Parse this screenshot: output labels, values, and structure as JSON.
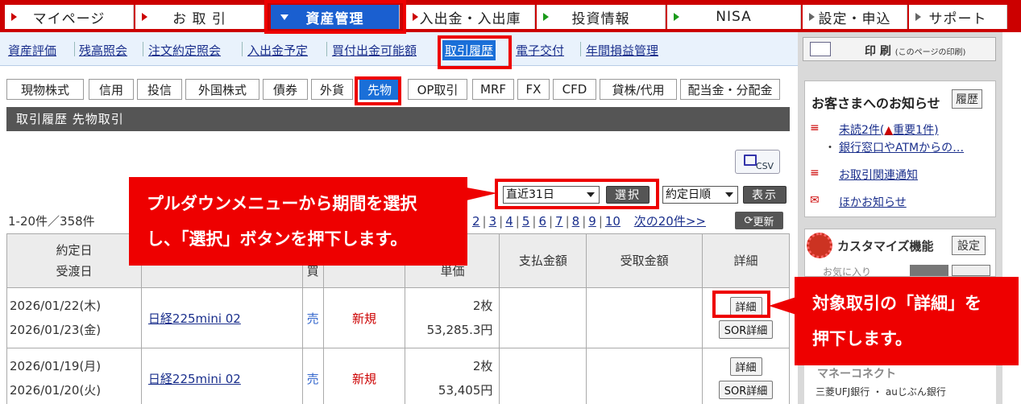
{
  "topnav": {
    "items": [
      {
        "label": "マイページ"
      },
      {
        "label": "お 取 引"
      },
      {
        "label": "資産管理"
      },
      {
        "label": "入出金・入出庫"
      },
      {
        "label": "投資情報"
      },
      {
        "label": "NISA"
      },
      {
        "label": "設定・申込"
      },
      {
        "label": "サポート"
      }
    ]
  },
  "subnav": {
    "items": [
      {
        "label": "資産評価"
      },
      {
        "label": "残高照会"
      },
      {
        "label": "注文約定照会"
      },
      {
        "label": "入出金予定"
      },
      {
        "label": "買付出金可能額"
      },
      {
        "label": "取引履歴"
      },
      {
        "label": "電子交付"
      },
      {
        "label": "年間損益管理"
      }
    ]
  },
  "tabs": [
    {
      "label": "現物株式"
    },
    {
      "label": "信用"
    },
    {
      "label": "投信"
    },
    {
      "label": "外国株式"
    },
    {
      "label": "債券"
    },
    {
      "label": "外貨"
    },
    {
      "label": "先物"
    },
    {
      "label": "OP取引"
    },
    {
      "label": "MRF"
    },
    {
      "label": "FX"
    },
    {
      "label": "CFD"
    },
    {
      "label": "貸株/代用"
    },
    {
      "label": "配当金・分配金"
    }
  ],
  "section_title": "取引履歴 先物取引",
  "csv_label": "CSV",
  "controls": {
    "period": "直近31日",
    "select_button": "選択",
    "sort": "約定日順",
    "show_button": "表示"
  },
  "count_text": "1-20件／358件",
  "pager": {
    "pages": [
      "2",
      "3",
      "4",
      "5",
      "6",
      "7",
      "8",
      "9",
      "10"
    ],
    "next": "次の20件>>",
    "refresh": "更新"
  },
  "table": {
    "headers": {
      "date_line1": "約定日",
      "date_line2": "受渡日",
      "side": "買",
      "qty_line2": "単価",
      "pay": "支払金額",
      "receive": "受取金額",
      "detail": "詳細"
    },
    "rows": [
      {
        "trade_date": "2026/01/22(木)",
        "settle_date": "2026/01/23(金)",
        "product": "日経225mini  02",
        "side": "売",
        "type": "新規",
        "qty": "2枚",
        "price": "53,285.3円",
        "detail": "詳細",
        "sor": "SOR詳細"
      },
      {
        "trade_date": "2026/01/19(月)",
        "settle_date": "2026/01/20(火)",
        "product": "日経225mini  02",
        "side": "売",
        "type": "新規",
        "qty": "2枚",
        "price": "53,405円",
        "detail": "詳細",
        "sor": "SOR詳細"
      }
    ]
  },
  "side": {
    "print_label": "印 刷",
    "print_sub": "(このページの印刷)",
    "notice_title": "お客さまへのお知らせ",
    "history_button": "履歴",
    "notice_unread": "未読2件(",
    "notice_important": "重要1件)",
    "notice_bank": "銀行窓口やATMからの…",
    "notice_trade": "お取引関連通知",
    "notice_other": "ほかお知らせ",
    "custom_title": "カスタマイズ機能",
    "custom_setting": "設定",
    "custom_fav": "お気に入り",
    "money_connect": "マネーコネクト",
    "bank_names": "三菱UFJ銀行 ・ auじぶん銀行"
  },
  "callouts": {
    "period_help": [
      "プルダウンメニューから期間を選択",
      "し、「選択」ボタンを押下します。"
    ],
    "detail_help": [
      "対象取引の「詳細」を",
      "押下します。"
    ]
  }
}
